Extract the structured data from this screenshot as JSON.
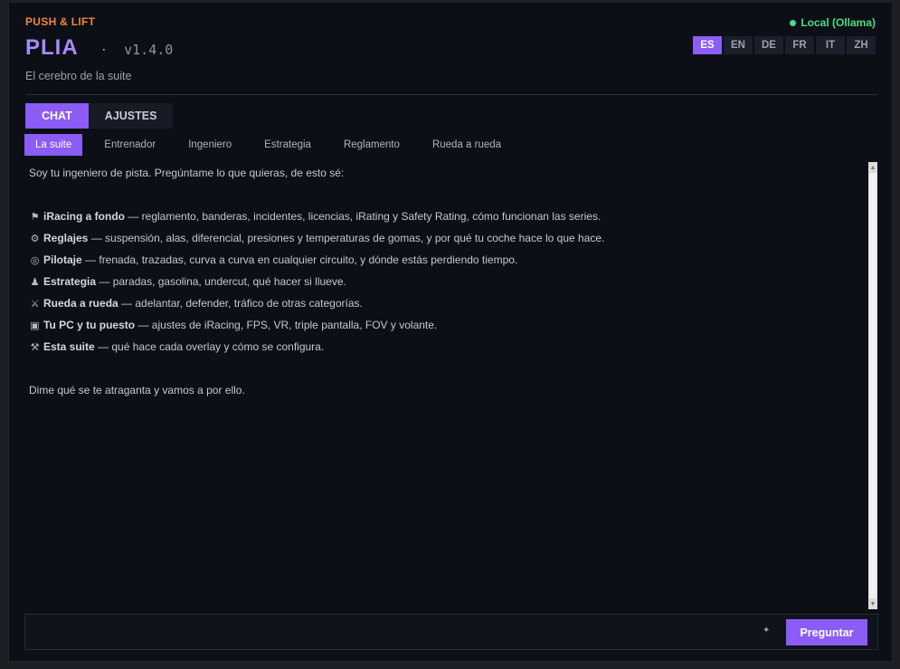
{
  "header": {
    "brand": "PUSH & LIFT",
    "title": "PLIA",
    "separator": "·",
    "version": "v1.4.0",
    "subtitle": "El cerebro de la suite",
    "status": "Local (Ollama)",
    "status_color": "#4ade80"
  },
  "languages": [
    {
      "code": "ES",
      "active": true
    },
    {
      "code": "EN",
      "active": false
    },
    {
      "code": "DE",
      "active": false
    },
    {
      "code": "FR",
      "active": false
    },
    {
      "code": "IT",
      "active": false
    },
    {
      "code": "ZH",
      "active": false
    }
  ],
  "tabs": [
    {
      "label": "CHAT",
      "active": true
    },
    {
      "label": "AJUSTES",
      "active": false
    }
  ],
  "subtabs": [
    {
      "label": "La suite",
      "active": true
    },
    {
      "label": "Entrenador",
      "active": false
    },
    {
      "label": "Ingeniero",
      "active": false
    },
    {
      "label": "Estrategia",
      "active": false
    },
    {
      "label": "Reglamento",
      "active": false
    },
    {
      "label": "Rueda a rueda",
      "active": false
    }
  ],
  "chat": {
    "intro": "Soy tu ingeniero de pista. Pregúntame lo que quieras, de esto sé:",
    "items": [
      {
        "icon": "⚑",
        "icon_name": "flag-icon",
        "title": "iRacing a fondo",
        "text": " — reglamento, banderas, incidentes, licencias, iRating y Safety Rating, cómo funcionan las series."
      },
      {
        "icon": "⚙",
        "icon_name": "gear-icon",
        "title": "Reglajes",
        "text": " — suspensión, alas, diferencial, presiones y temperaturas de gomas, y por qué tu coche hace lo que hace."
      },
      {
        "icon": "◎",
        "icon_name": "target-icon",
        "title": "Pilotaje",
        "text": " — frenada, trazadas, curva a curva en cualquier circuito, y dónde estás perdiendo tiempo."
      },
      {
        "icon": "♟",
        "icon_name": "pawn-icon",
        "title": "Estrategia",
        "text": " — paradas, gasolina, undercut, qué hacer si llueve."
      },
      {
        "icon": "⚔",
        "icon_name": "crossed-swords-icon",
        "title": "Rueda a rueda",
        "text": " — adelantar, defender, tráfico de otras categorías."
      },
      {
        "icon": "▣",
        "icon_name": "pc-icon",
        "title": "Tu PC y tu puesto",
        "text": " — ajustes de iRacing, FPS, VR, triple pantalla, FOV y volante."
      },
      {
        "icon": "⚒",
        "icon_name": "tools-icon",
        "title": "Esta suite",
        "text": " — qué hace cada overlay y cómo se configura."
      }
    ],
    "outro": "Dime qué se te atraganta y vamos a por ello."
  },
  "composer": {
    "placeholder": "",
    "sparkle": "✦",
    "send_label": "Preguntar"
  },
  "colors": {
    "accent": "#8b5cf6",
    "brand": "#f0883e",
    "background": "#0c0f16"
  }
}
